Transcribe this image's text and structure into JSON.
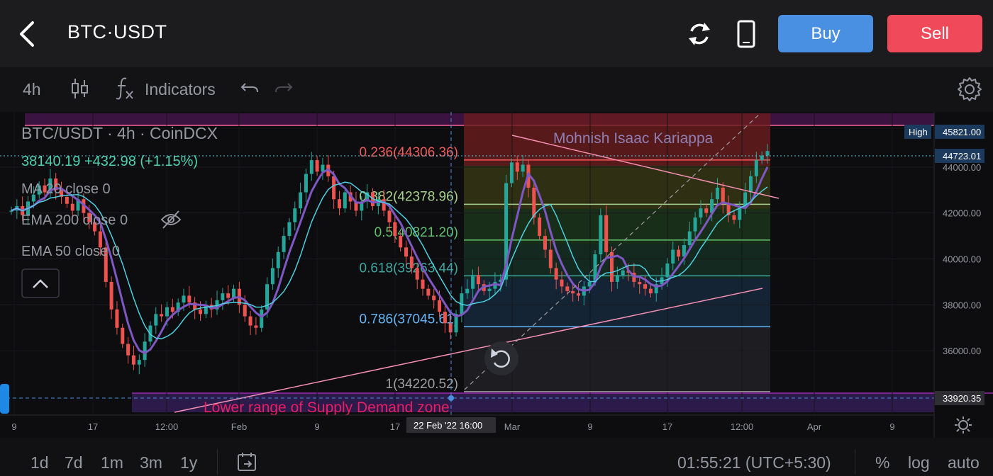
{
  "header": {
    "title": "BTC·USDT",
    "buy_label": "Buy",
    "sell_label": "Sell"
  },
  "toolbar": {
    "interval": "4h",
    "indicators_label": "Indicators"
  },
  "chart_data": {
    "type": "candlestick",
    "title": "BTC/USDT · 4h · CoinDCX",
    "price_line": "38140.19  +432.98 (+1.15%)",
    "indicators": [
      "MA 20 close 0",
      "EMA 200 close 0",
      "EMA 50 close 0"
    ],
    "watermark": "Mohnish Isaac Kariappa",
    "y_ticks": [
      "44000.00",
      "42000.00",
      "40000.00",
      "38000.00",
      "36000.00"
    ],
    "ylim": [
      33200,
      46400
    ],
    "x_ticks": [
      "9",
      "17",
      "12:00",
      "Feb",
      "9",
      "17",
      "Mar",
      "9",
      "17",
      "12:00",
      "Apr",
      "9"
    ],
    "crosshair_x": "22 Feb '22   16:00",
    "markers": {
      "high_label": "High",
      "high_value": "45821.00",
      "last_value": "44723.01",
      "cursor_value": "33920.35"
    },
    "fib_levels": [
      {
        "label": "0.236(44306.36)",
        "value": 44306.36,
        "color": "#f05a5a"
      },
      {
        "label": "0.382(42378.96)",
        "value": 42378.96,
        "color": "#a8d08d"
      },
      {
        "label": "0.5(40821.20)",
        "value": 40821.2,
        "color": "#5fbf6b"
      },
      {
        "label": "0.618(39263.44)",
        "value": 39263.44,
        "color": "#3aa7a0"
      },
      {
        "label": "0.786(37045.61)",
        "value": 37045.61,
        "color": "#64b5f6"
      },
      {
        "label": "1(34220.52)",
        "value": 34220.52,
        "color": "#9e9e9e"
      }
    ],
    "zone_label": "Lower range of Supply Demand zone",
    "closes": [
      42100,
      42300,
      41900,
      42500,
      42800,
      43200,
      42900,
      43500,
      43000,
      42700,
      42400,
      42100,
      42600,
      42000,
      41600,
      41200,
      40500,
      39000,
      37800,
      37000,
      36300,
      35800,
      35400,
      35600,
      36400,
      37100,
      37600,
      37500,
      37900,
      37700,
      38100,
      38400,
      38100,
      37800,
      37600,
      38000,
      37800,
      38200,
      38500,
      38300,
      38700,
      38000,
      37500,
      37100,
      37000,
      37800,
      38900,
      39600,
      40300,
      41000,
      41600,
      42200,
      42900,
      43700,
      44300,
      43800,
      44100,
      43600,
      42600,
      42200,
      42900,
      42500,
      42100,
      42500,
      42900,
      42300,
      42600,
      42100,
      41600,
      41000,
      40500,
      40100,
      39600,
      39100,
      38700,
      38400,
      38200,
      37700,
      37200,
      36800,
      37600,
      38500,
      38700,
      39300,
      38900,
      38600,
      38700,
      39000,
      39100,
      43300,
      44200,
      43800,
      44100,
      43100,
      41800,
      41000,
      40400,
      39600,
      39100,
      38800,
      38600,
      38500,
      38400,
      38800,
      39000,
      40200,
      41900,
      40300,
      39000,
      39300,
      39500,
      39400,
      39000,
      38900,
      38700,
      38500,
      38900,
      39200,
      39800,
      40400,
      40100,
      40600,
      41200,
      41800,
      42200,
      42000,
      42600,
      43100,
      42400,
      41900,
      41700,
      42200,
      42900,
      43600,
      44300,
      44500,
      44700
    ]
  },
  "controls": {
    "collapse_icon": "chevron-up-icon",
    "hide_icon": "eye-off-icon",
    "reset_icon": "reset-icon"
  },
  "bottom": {
    "ranges": [
      "1d",
      "7d",
      "1m",
      "3m",
      "1y"
    ],
    "time": "01:55:21 (UTC+5:30)",
    "percent": "%",
    "log": "log",
    "auto": "auto"
  }
}
